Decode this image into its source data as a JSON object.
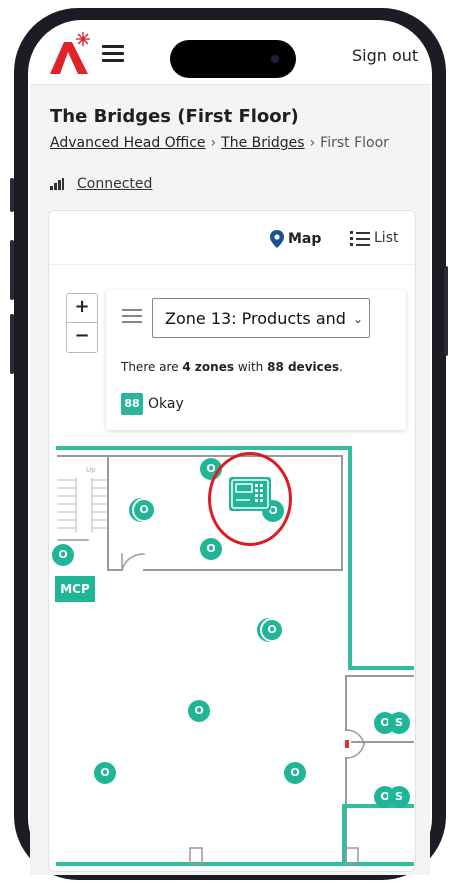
{
  "header": {
    "sign_out": "Sign out"
  },
  "page": {
    "title": "The Bridges (First Floor)",
    "breadcrumb": [
      "Advanced Head Office",
      "The Bridges",
      "First Floor"
    ],
    "connection_status": "Connected"
  },
  "view_toggle": {
    "map": "Map",
    "list": "List",
    "active": "map"
  },
  "zoom": {
    "in": "+",
    "out": "−"
  },
  "zone_panel": {
    "selected_zone": "Zone 13: Products and",
    "summary_prefix": "There are ",
    "zones": "4 zones",
    "summary_mid": " with ",
    "devices": "88 devices",
    "summary_suffix": ".",
    "status_count": "88",
    "status_label": "Okay"
  },
  "map": {
    "stair_label": "Up",
    "mcp_label": "MCP",
    "device_label": "O",
    "sounder_label": "S"
  },
  "colors": {
    "accent": "#1fb596",
    "wall": "#2fbf9e",
    "highlight": "#e01a22",
    "logo": "#e0222a"
  },
  "icons": [
    "menu-icon",
    "map-pin-icon",
    "list-icon",
    "signal-icon",
    "control-panel-icon",
    "logo"
  ]
}
